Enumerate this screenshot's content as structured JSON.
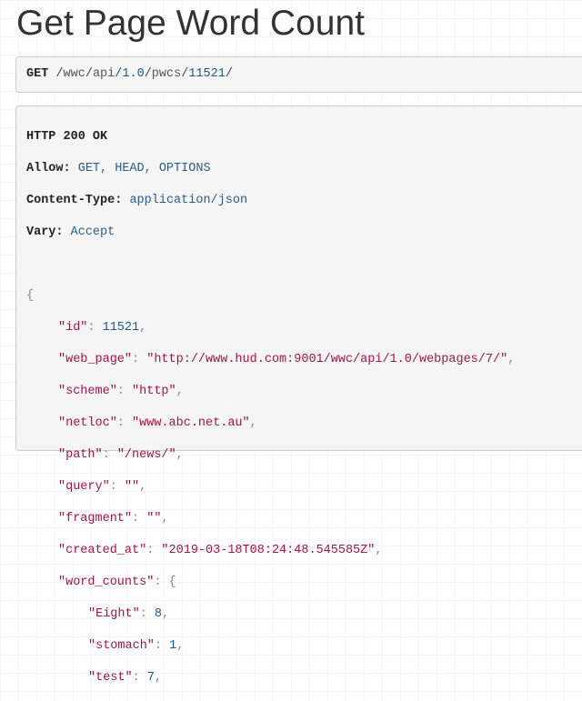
{
  "page": {
    "title": "Get Page Word Count"
  },
  "request": {
    "method": "GET",
    "path_parts": [
      "wwc",
      "api",
      "1.0",
      "pwcs",
      "11521"
    ]
  },
  "response": {
    "status_line": "HTTP 200 OK",
    "headers": [
      {
        "name": "Allow:",
        "value": "GET, HEAD, OPTIONS"
      },
      {
        "name": "Content-Type:",
        "value": "application/json"
      },
      {
        "name": "Vary:",
        "value": "Accept"
      }
    ],
    "body": {
      "open_brace": "{",
      "fields": {
        "id": {
          "key": "\"id\"",
          "value": "11521"
        },
        "web_page": {
          "key": "\"web_page\"",
          "value": "\"http://www.hud.com:9001/wwc/api/1.0/webpages/7/\""
        },
        "scheme": {
          "key": "\"scheme\"",
          "value": "\"http\""
        },
        "netloc": {
          "key": "\"netloc\"",
          "value": "\"www.abc.net.au\""
        },
        "path": {
          "key": "\"path\"",
          "value": "\"/news/\""
        },
        "query": {
          "key": "\"query\"",
          "value": "\"\""
        },
        "fragment": {
          "key": "\"fragment\"",
          "value": "\"\""
        },
        "created_at": {
          "key": "\"created_at\"",
          "value": "\"2019-03-18T08:24:48.545585Z\""
        },
        "word_counts": {
          "key": "\"word_counts\"",
          "open": "{"
        }
      },
      "word_counts_entries": [
        {
          "key": "\"Eight\"",
          "value": "8"
        },
        {
          "key": "\"stomach\"",
          "value": "1"
        },
        {
          "key": "\"test\"",
          "value": "7"
        }
      ]
    }
  }
}
